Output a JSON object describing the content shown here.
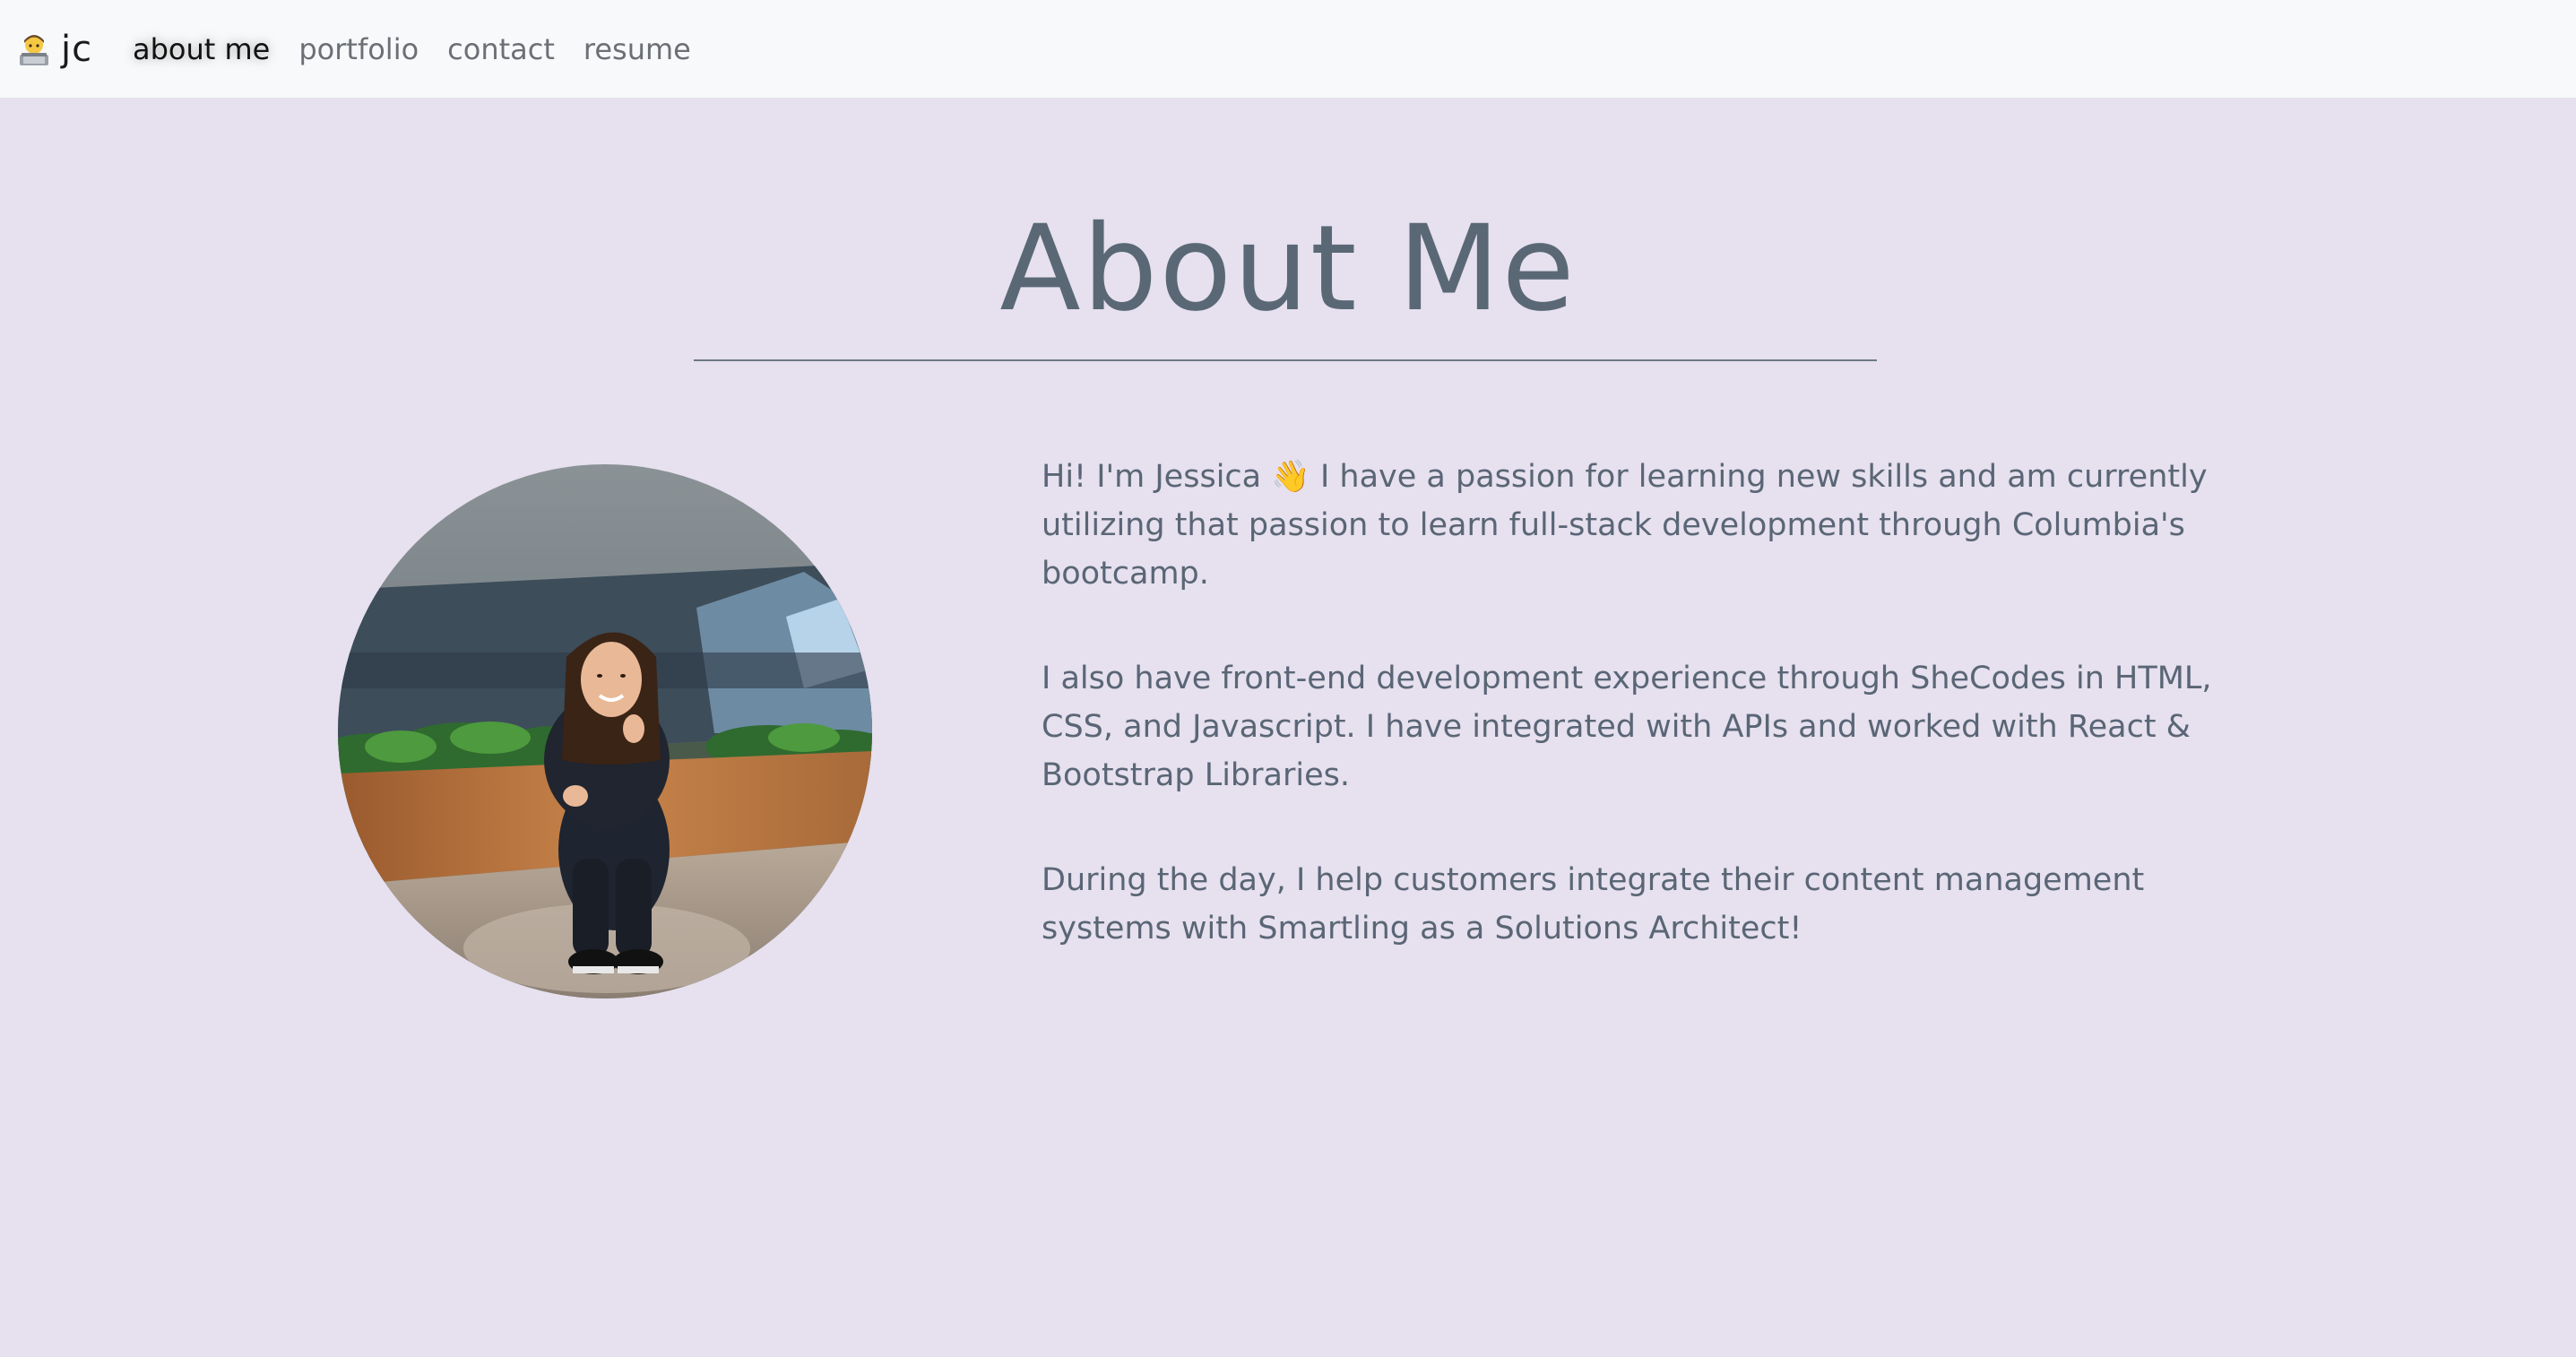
{
  "navbar": {
    "brand_icon": "technologist-emoji-icon",
    "brand_text": "jc",
    "links": [
      {
        "label": "about me",
        "active": true
      },
      {
        "label": "portfolio",
        "active": false
      },
      {
        "label": "contact",
        "active": false
      },
      {
        "label": "resume",
        "active": false
      }
    ]
  },
  "main": {
    "title": "About Me",
    "portrait_icon": "profile-photo",
    "paragraphs": [
      {
        "before_emoji": "Hi! I'm Jessica ",
        "emoji": "👋",
        "after_emoji": " I have a passion for learning new skills and am currently utilizing that passion to learn full-stack development through Columbia's bootcamp."
      },
      {
        "text": "I also have front-end development experience through SheCodes in HTML, CSS, and Javascript. I have integrated with APIs and worked with React & Bootstrap Libraries."
      },
      {
        "text": "During the day, I help customers integrate their content management systems with Smartling as a Solutions Architect!"
      }
    ]
  },
  "colors": {
    "page_background": "#e6e0ef",
    "navbar_background": "#f8f9fa",
    "title_color": "#5a6876",
    "text_color": "#5a6675"
  }
}
